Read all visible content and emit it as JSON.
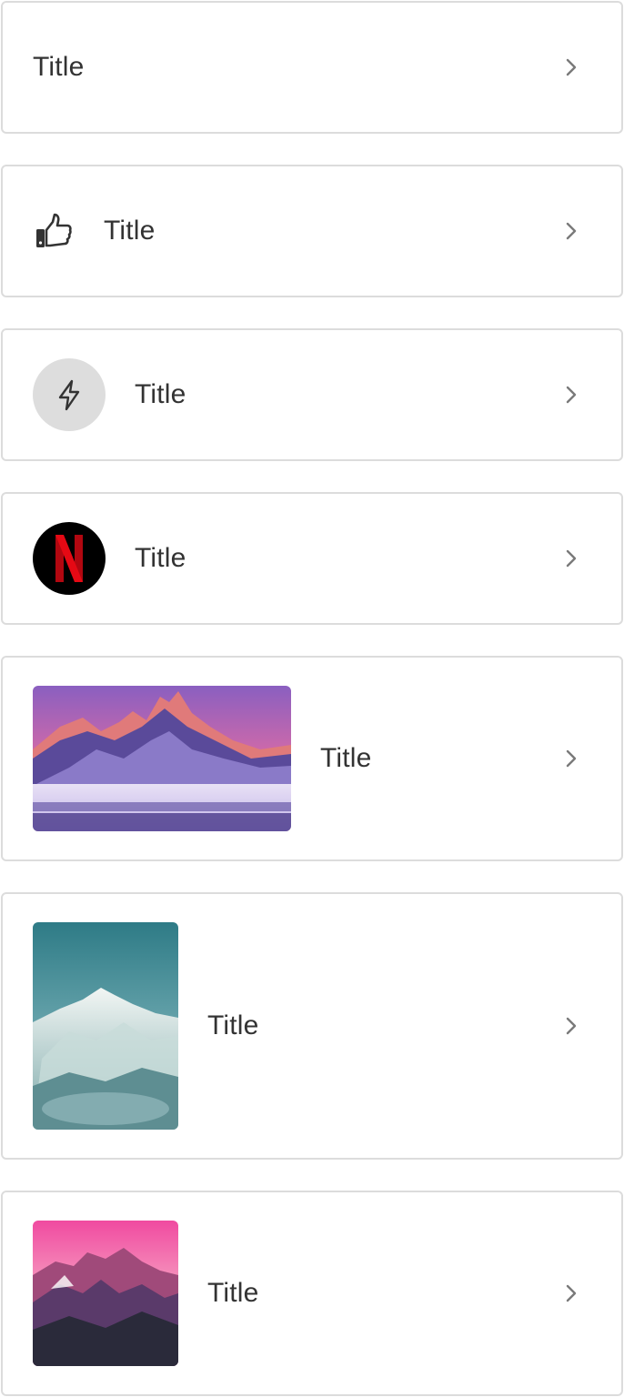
{
  "items": [
    {
      "title": "Title",
      "leading": "none"
    },
    {
      "title": "Title",
      "leading": "thumbs-up-icon"
    },
    {
      "title": "Title",
      "leading": "lightning-icon"
    },
    {
      "title": "Title",
      "leading": "netflix-logo"
    },
    {
      "title": "Title",
      "leading": "mountain-sunset-image"
    },
    {
      "title": "Title",
      "leading": "snowy-peak-image"
    },
    {
      "title": "Title",
      "leading": "pink-sky-mountain-image"
    }
  ],
  "trailing_icon": "chevron-right-icon",
  "colors": {
    "border": "#dcdcdc",
    "text": "#333333",
    "chevron": "#7a7a7a",
    "avatar_grey": "#dddddd",
    "netflix_red": "#d81f26"
  }
}
